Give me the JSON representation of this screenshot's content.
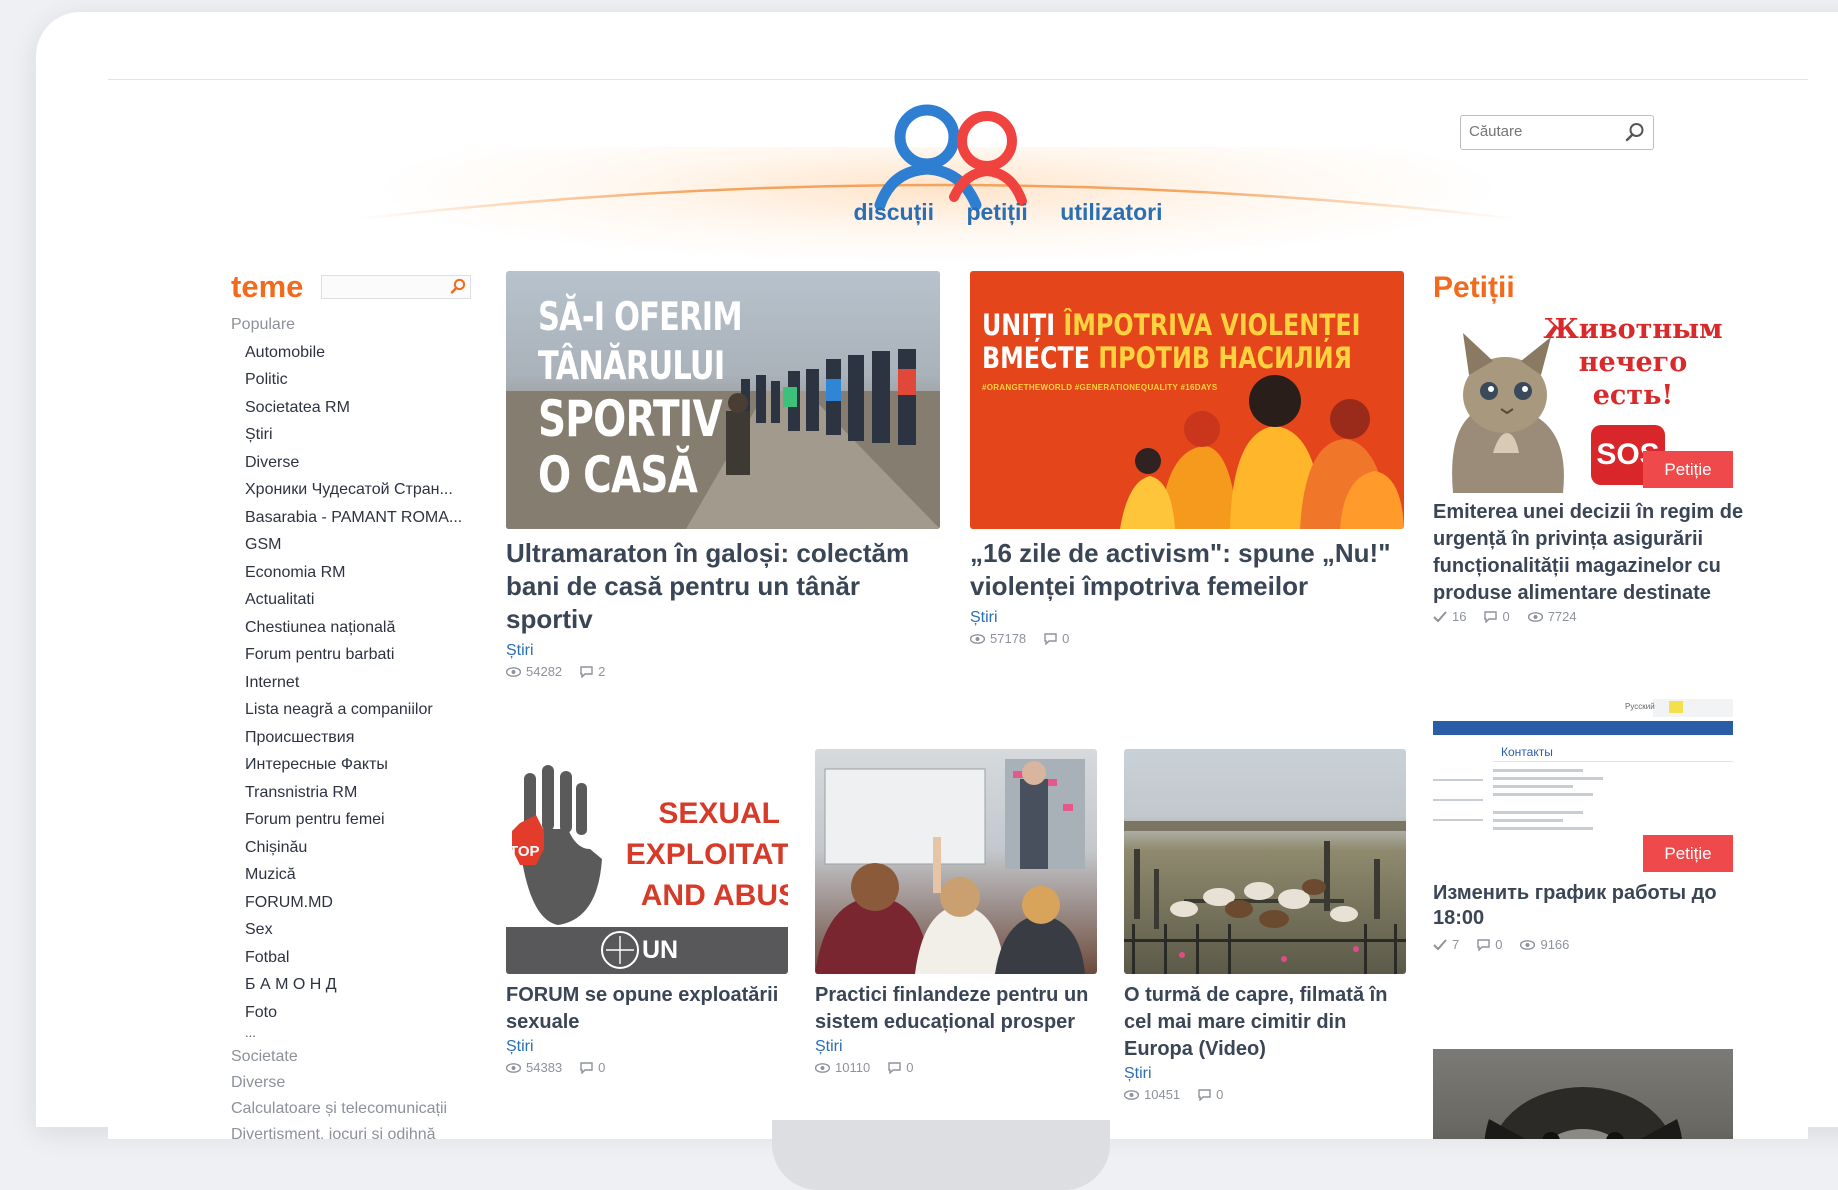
{
  "header": {
    "nav": [
      "discuții",
      "petiții",
      "utilizatori"
    ],
    "search_placeholder": "Căutare"
  },
  "sidebar": {
    "title": "teme",
    "popular_label": "Populare",
    "popular_items": [
      "Automobile",
      "Politic",
      "Societatea RM",
      "Știri",
      "Diverse",
      "Хроники Чудесатой Стран...",
      "Basarabia - PAMANT ROMA...",
      "GSM",
      "Economia RM",
      "Actualitati",
      "Chestiunea națională",
      "Forum pentru barbati",
      "Internet",
      "Lista neagră a companiilor",
      "Происшествия",
      "Интересные Факты",
      "Transnistria RM",
      "Forum pentru femei",
      "Chișinău",
      "Muzică",
      "FORUM.MD",
      "Sex",
      "Fotbal",
      "Б А М О Н Д",
      "Foto",
      "..."
    ],
    "groups": [
      "Societate",
      "Diverse",
      "Calculatoare și telecomunicații",
      "Divertisment, jocuri și odihnă"
    ]
  },
  "news": [
    {
      "title": "Ultramaraton în galoși: colectăm bani de casă pentru un tânăr sportiv",
      "category": "Știri",
      "views": "54282",
      "comments": "2",
      "image_text": [
        "SĂ-I OFERIM",
        "TÂNĂRULUI",
        "SPORTIV",
        "O CASĂ"
      ]
    },
    {
      "title": "„16 zile de activism\": spune „Nu!\" violenței împotriva femeilor",
      "category": "Știri",
      "views": "57178",
      "comments": "0",
      "image_text": [
        "UNIȚI",
        "ÎMPOTRIVA VIOLENȚEI",
        "ВМЕСТЕ",
        "ПРОТИВ НАСИЛИЯ",
        "#ORANGETHEWORLD #GENERATIONEQUALITY #16DAYS"
      ]
    },
    {
      "title": "FORUM se opune exploatării sexuale",
      "category": "Știri",
      "views": "54383",
      "comments": "0",
      "image_text": [
        "SEXUAL",
        "EXPLOITATI",
        "AND ABUS",
        "TOP",
        "UN"
      ]
    },
    {
      "title": "Practici finlandeze pentru un sistem educațional prosper",
      "category": "Știri",
      "views": "10110",
      "comments": "0"
    },
    {
      "title": "O turmă de capre, filmată în cel mai mare cimitir din Europa (Video)",
      "category": "Știri",
      "views": "10451",
      "comments": "0"
    }
  ],
  "petitions": {
    "title": "Petiții",
    "badge": "Petiție",
    "items": [
      {
        "title": "Emiterea unei decizii în regim de urgență în privința asigurării funcționalității magazinelor cu produse alimentare destinate animalelor și păsărilor de",
        "votes": "16",
        "comments": "0",
        "views": "7724",
        "image_text": [
          "Животным",
          "нечего",
          "есть!",
          "SOS"
        ]
      },
      {
        "title": "Изменить график работы до 18:00",
        "votes": "7",
        "comments": "0",
        "views": "9166",
        "image_text": [
          "Контакты",
          "Русский"
        ]
      },
      {
        "title": "",
        "votes": "",
        "comments": "",
        "views": ""
      }
    ]
  },
  "colors": {
    "accent_orange": "#f26a1b",
    "link_blue": "#2a6eb4",
    "badge_red": "#f0494b",
    "logo_blue": "#2e7fd1",
    "logo_red": "#f0433f"
  }
}
